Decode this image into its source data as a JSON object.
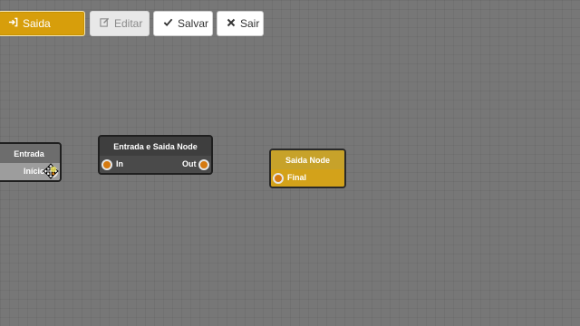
{
  "toolbar": {
    "saida_label": "Saida",
    "saida_icon": "sign-in-icon",
    "editar_label": "Editar",
    "editar_icon": "edit-icon",
    "salvar_label": "Salvar",
    "salvar_icon": "check-icon",
    "sair_label": "Sair",
    "sair_icon": "close-icon"
  },
  "nodes": {
    "entrada": {
      "title": "Entrada",
      "output_label": "Início"
    },
    "entrada_saida": {
      "title": "Entrada e Saida Node",
      "input_label": "In",
      "output_label": "Out"
    },
    "saida": {
      "title": "Saida Node",
      "input_label": "Final"
    }
  },
  "colors": {
    "canvas": "#777777",
    "accent": "#d79e0b",
    "port": "#d67a10",
    "node_dark": "#3e3e3e",
    "node_gold": "#c99c1f"
  },
  "cursor": "move-cursor-icon"
}
